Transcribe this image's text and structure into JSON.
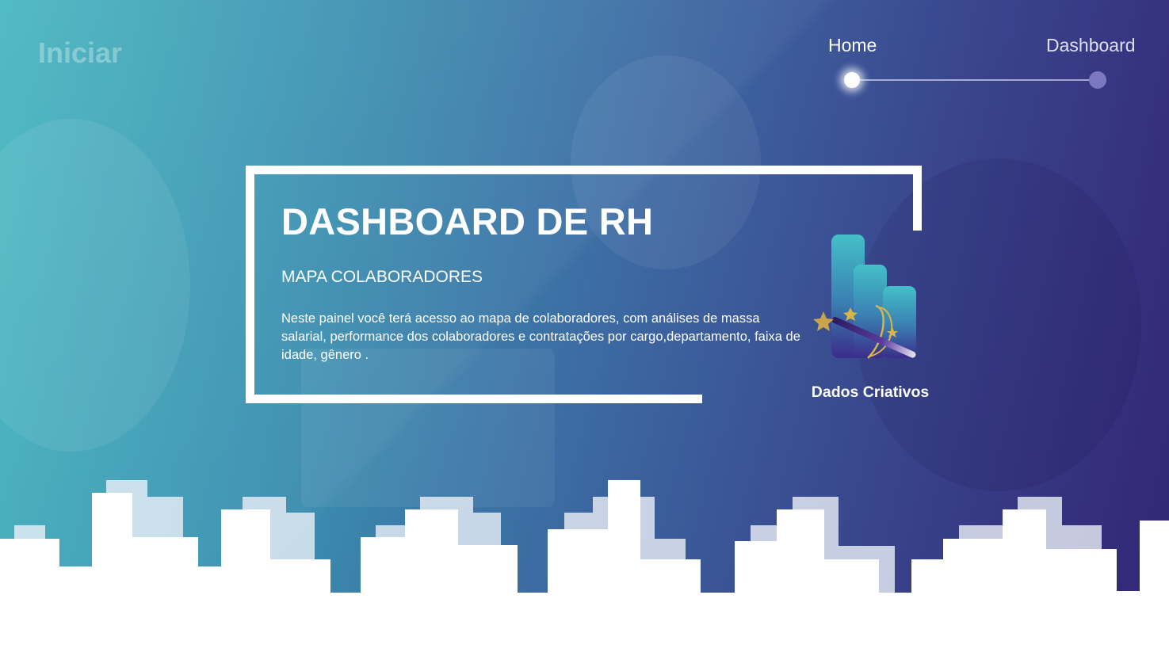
{
  "header": {
    "brand": "Iniciar",
    "nav": [
      {
        "label": "Home",
        "active": true
      },
      {
        "label": "Dashboard",
        "active": false
      }
    ]
  },
  "hero": {
    "title": "DASHBOARD DE RH",
    "subtitle": "MAPA COLABORADORES",
    "description": "Neste painel você terá acesso ao mapa de colaboradores, com análises de  massa salarial, performance dos colaboradores e contratações por cargo,departamento, faixa de idade, gênero ."
  },
  "logo": {
    "label": "Dados Criativos",
    "icon": "bar-chart-magic-wand-icon"
  },
  "colors": {
    "gradient_start": "#3fb3bd",
    "gradient_mid": "#3d6aa3",
    "gradient_end": "#35287a",
    "text": "#ffffff",
    "nav_dot_inactive": "#7c78bf"
  }
}
